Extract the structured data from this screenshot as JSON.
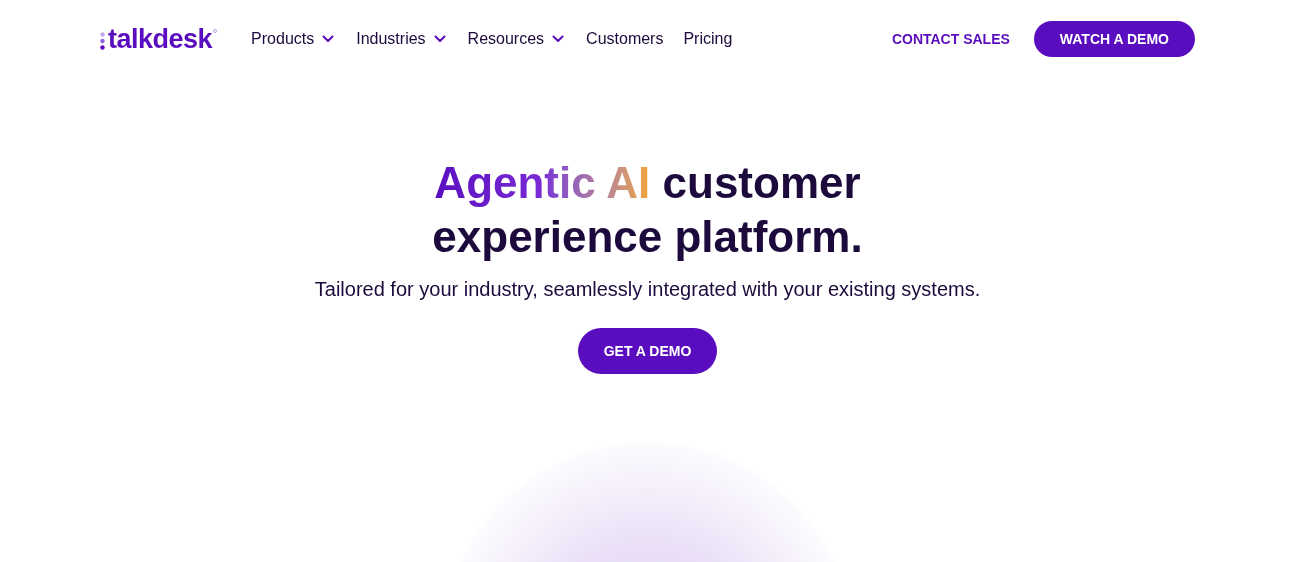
{
  "logo": {
    "text": "talkdesk"
  },
  "nav": [
    {
      "label": "Products",
      "has_menu": true
    },
    {
      "label": "Industries",
      "has_menu": true
    },
    {
      "label": "Resources",
      "has_menu": true
    },
    {
      "label": "Customers",
      "has_menu": false
    },
    {
      "label": "Pricing",
      "has_menu": false
    }
  ],
  "header_actions": [
    {
      "label": "CONTACT SALES",
      "kind": "link"
    },
    {
      "label": "WATCH A DEMO",
      "kind": "button"
    }
  ],
  "hero": {
    "headline_highlight": "Agentic AI",
    "headline_rest": "customer experience platform.",
    "subtitle": "Tailored for your industry, seamlessly integrated with your existing systems.",
    "cta": "GET A DEMO"
  }
}
